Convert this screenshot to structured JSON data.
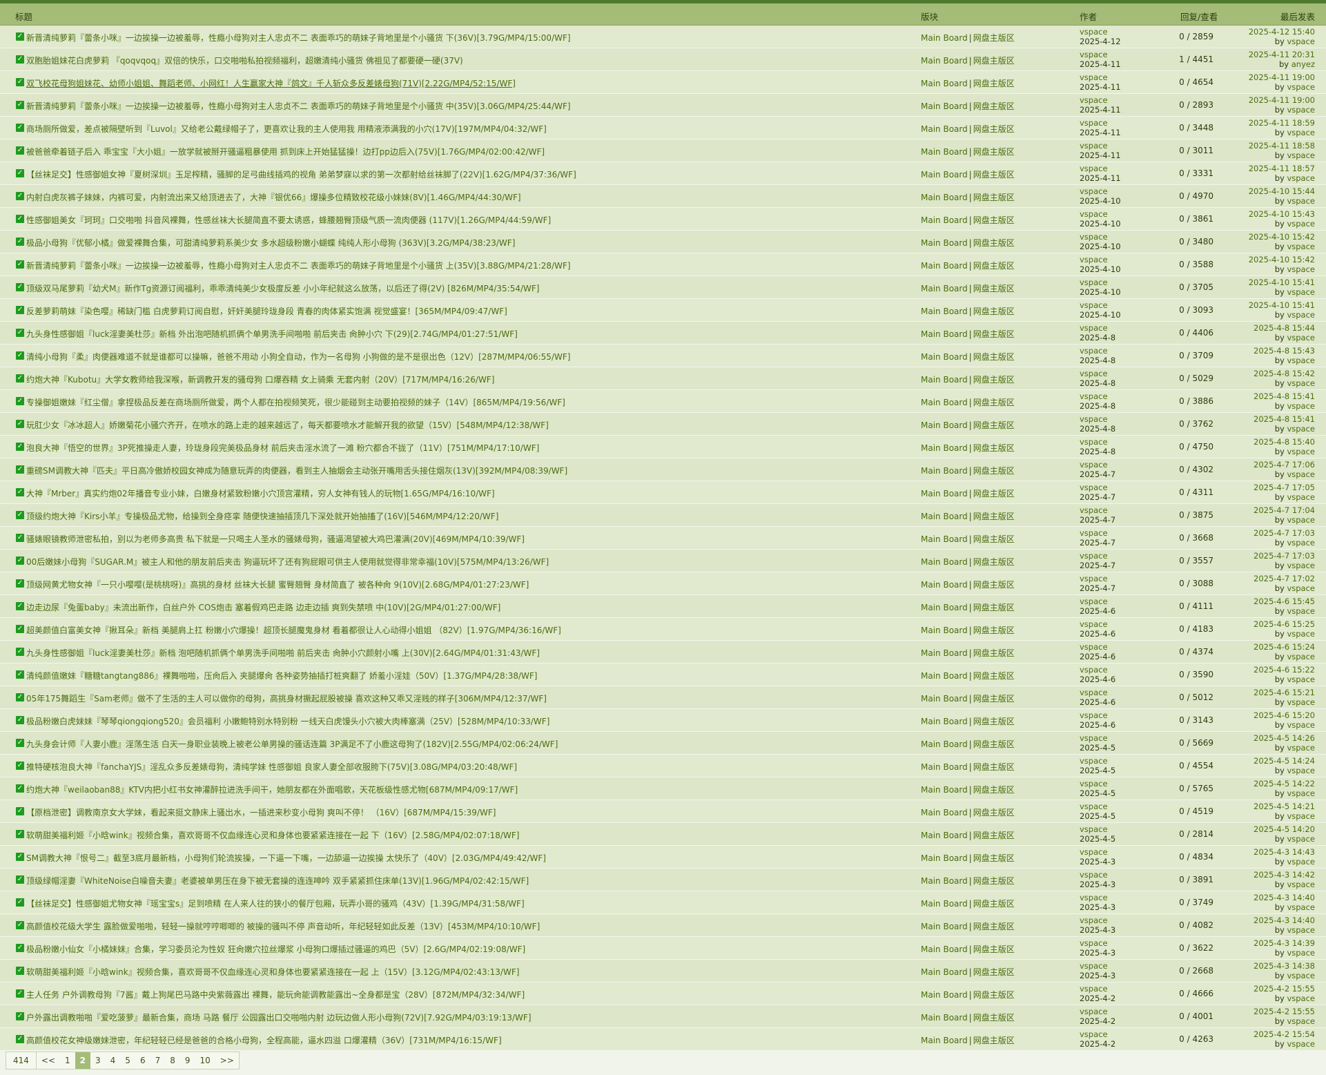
{
  "header": {
    "title": "标题",
    "board": "版块",
    "author": "作者",
    "stats": "回复/查看",
    "last": "最后发表"
  },
  "board_name": [
    "Main Board",
    "网盘主版区"
  ],
  "threads": [
    {
      "title": "新晋清纯萝莉『蕾条小咪』一边挨操一边被羞辱，性瘾小母狗对主人忠贞不二 表面乖巧的萌妹子背地里是个小骚货 下(36V)[3.79G/MP4/15:00/WF]",
      "author": "vspace",
      "date": "2025-4-12",
      "stats": "0 / 2859",
      "last": "2025-4-12 15:40",
      "by": "vspace"
    },
    {
      "title": "双胞胎姐妹花白虎萝莉 『qoqvqoq』双倍的快乐，口交啪啪私拍视频福利，超嫩清纯小骚货 佛祖见了都要硬一硬(37V)",
      "author": "vspace",
      "date": "2025-4-11",
      "stats": "1 / 4451",
      "last": "2025-4-11 20:31",
      "by": "anyez"
    },
    {
      "title": "双飞校花母狗姐妹花、幼师小姐姐、舞蹈老师、小网红！人生赢家大神『鸽文』千人斩众多反差婊母狗(71V)[2.22G/MP4/52:15/WF]",
      "author": "vspace",
      "date": "2025-4-11",
      "stats": "0 / 4654",
      "last": "2025-4-11 19:00",
      "by": "vspace",
      "underline": true
    },
    {
      "title": "新晋清纯萝莉『蕾条小咪』一边挨操一边被羞辱，性瘾小母狗对主人忠贞不二 表面乖巧的萌妹子背地里是个小骚货 中(35V)[3.06G/MP4/25:44/WF]",
      "author": "vspace",
      "date": "2025-4-11",
      "stats": "0 / 2893",
      "last": "2025-4-11 19:00",
      "by": "vspace"
    },
    {
      "title": "商场厕所做爱，差点被隔壁听到『Luvol』又给老公戴绿帽子了，更喜欢让我的主人使用我 用精液添满我的小穴(17V)[197M/MP4/04:32/WF]",
      "author": "vspace",
      "date": "2025-4-11",
      "stats": "0 / 3448",
      "last": "2025-4-11 18:59",
      "by": "vspace"
    },
    {
      "title": "被爸爸牵着链子后入 乖宝宝『大小姐』一放学就被掰开骚逼粗暴使用 抓到床上开始猛猛操！边打pp边后入(75V)[1.76G/MP4/02:00:42/WF]",
      "author": "vspace",
      "date": "2025-4-11",
      "stats": "0 / 3011",
      "last": "2025-4-11 18:58",
      "by": "vspace"
    },
    {
      "title": "【丝袜足交】性感御姐女神『夏树深圳』玉足榨精，骚脚的足弓曲线插鸡的视角 弟弟梦寐以求的第一次都射给丝袜脚了(22V)[1.62G/MP4/37:36/WF]",
      "author": "vspace",
      "date": "2025-4-11",
      "stats": "0 / 3331",
      "last": "2025-4-11 18:57",
      "by": "vspace"
    },
    {
      "title": "内射白虎灰裤子妹妹，内裤可爱，内射流出来又给顶进去了，大神『银优66』爆操多位精致校花级小妹妹(8V)[1.46G/MP4/44:30/WF]",
      "author": "vspace",
      "date": "2025-4-10",
      "stats": "0 / 4970",
      "last": "2025-4-10 15:44",
      "by": "vspace"
    },
    {
      "title": "性感御姐美女『珂珂』口交啪啪 抖音风裸舞，性感丝袜大长腿简直不要太诱惑，蜂腰翘臀顶级气质一流肉便器 (117V)[1.26G/MP4/44:59/WF]",
      "author": "vspace",
      "date": "2025-4-10",
      "stats": "0 / 3861",
      "last": "2025-4-10 15:43",
      "by": "vspace"
    },
    {
      "title": "极品小母狗『优郁小橘』做爱裸舞合集，可甜清纯萝莉系美少女 多水超级粉嫩小蝴蝶 纯纯人形小母狗 (363V)[3.2G/MP4/38:23/WF]",
      "author": "vspace",
      "date": "2025-4-10",
      "stats": "0 / 3480",
      "last": "2025-4-10 15:42",
      "by": "vspace"
    },
    {
      "title": "新晋清纯萝莉『蕾条小咪』一边挨操一边被羞辱，性瘾小母狗对主人忠贞不二 表面乖巧的萌妹子背地里是个小骚货 上(35V)[3.88G/MP4/21:28/WF]",
      "author": "vspace",
      "date": "2025-4-10",
      "stats": "0 / 3588",
      "last": "2025-4-10 15:42",
      "by": "vspace"
    },
    {
      "title": "顶级双马尾萝莉『幼犬M』新作Tg资源订阅福利，乖乖清纯美少女极度反差 小小年纪就这么放荡，以后还了得(2V) [826M/MP4/35:54/WF]",
      "author": "vspace",
      "date": "2025-4-10",
      "stats": "0 / 3705",
      "last": "2025-4-10 15:41",
      "by": "vspace"
    },
    {
      "title": "反差萝莉萌妹『染色嘤』稀缺门槛 白虎萝莉订阅自慰，奸奸美腿玲珑身段 青春的肉体紧实饱满 视觉盛宴！[365M/MP4/09:47/WF]",
      "author": "vspace",
      "date": "2025-4-10",
      "stats": "0 / 3093",
      "last": "2025-4-10 15:41",
      "by": "vspace"
    },
    {
      "title": "九头身性感御姐『luck淫妻美杜莎』新档 外出泡吧随机抓俩个单男洗手间啪啪 前后夹击 肏肿小穴 下(29)[2.74G/MP4/01:27:51/WF]",
      "author": "vspace",
      "date": "2025-4-8",
      "stats": "0 / 4406",
      "last": "2025-4-8 15:44",
      "by": "vspace"
    },
    {
      "title": "清纯小母狗『柔』肉便器难道不就是谁都可以操嘛，爸爸不用动 小狗全自动，作为一名母狗 小狗做的是不是很出色（12V）[287M/MP4/06:55/WF]",
      "author": "vspace",
      "date": "2025-4-8",
      "stats": "0 / 3709",
      "last": "2025-4-8 15:43",
      "by": "vspace"
    },
    {
      "title": "约炮大神『Kubotu』大学女教师给我深喉，新调教开发的骚母狗 口爆吞精 女上骑乘 无套内射（20V）[717M/MP4/16:26/WF]",
      "author": "vspace",
      "date": "2025-4-8",
      "stats": "0 / 5029",
      "last": "2025-4-8 15:42",
      "by": "vspace"
    },
    {
      "title": "专操御姐嫩妹『红尘僧』拿捏极品反差在商场厕所做爱，两个人都在拍视频笑死，很少能碰到主动要拍视频的妹子（14V）[865M/MP4/19:56/WF]",
      "author": "vspace",
      "date": "2025-4-8",
      "stats": "0 / 3886",
      "last": "2025-4-8 15:41",
      "by": "vspace"
    },
    {
      "title": "玩肛少女『冰冰超人』娇嫩菊花小骚穴齐开，在喷水的路上走的越来越远了，每天都要喷水才能解开我的欲望（15V）[548M/MP4/12:38/WF]",
      "author": "vspace",
      "date": "2025-4-8",
      "stats": "0 / 3762",
      "last": "2025-4-8 15:41",
      "by": "vspace"
    },
    {
      "title": "泡良大神『悟空的世界』3P死推操走人妻，玲珑身段完美极品身材 前后夹击淫水流了一滩 粉穴都合不拢了（11V）[751M/MP4/17:10/WF]",
      "author": "vspace",
      "date": "2025-4-8",
      "stats": "0 / 4750",
      "last": "2025-4-8 15:40",
      "by": "vspace"
    },
    {
      "title": "重磅SM调教大神『匹夫』平日高冷傲娇校园女神成为随意玩弄的肉便器，看到主人抽烟会主动张开嘴用舌头接住烟灰(13V)[392M/MP4/08:39/WF]",
      "author": "vspace",
      "date": "2025-4-7",
      "stats": "0 / 4302",
      "last": "2025-4-7 17:06",
      "by": "vspace"
    },
    {
      "title": "大神『Mrber』真实约炮02年播音专业小妹，白嫩身材紧致粉嫩小穴顶宫灌精，穷人女神有钱人的玩物[1.65G/MP4/16:10/WF]",
      "author": "vspace",
      "date": "2025-4-7",
      "stats": "0 / 4311",
      "last": "2025-4-7 17:05",
      "by": "vspace"
    },
    {
      "title": "顶级约炮大神『Kirs小羊』专操极品尤物，给操到全身痉挛 随便快速抽插顶几下深处就开始抽搐了(16V)[546M/MP4/12:20/WF]",
      "author": "vspace",
      "date": "2025-4-7",
      "stats": "0 / 3875",
      "last": "2025-4-7 17:04",
      "by": "vspace"
    },
    {
      "title": "骚婊眼镜教师泄密私拍，别以为老师多高贵 私下就是一只喝主人圣水的骚婊母狗，骚逼渴望被大鸡巴灌满(20V)[469M/MP4/10:39/WF]",
      "author": "vspace",
      "date": "2025-4-7",
      "stats": "0 / 3668",
      "last": "2025-4-7 17:03",
      "by": "vspace"
    },
    {
      "title": "00后嫩妹小母狗『SUGAR.M』被主人和他的朋友前后夹击 狗逼玩坏了还有狗屁眼可供主人使用就觉得非常幸福(10V)[575M/MP4/13:26/WF]",
      "author": "vspace",
      "date": "2025-4-7",
      "stats": "0 / 3557",
      "last": "2025-4-7 17:03",
      "by": "vspace"
    },
    {
      "title": "顶级网黄尤物女神『一只小嘤嘤(是桃桃呀)』高挑的身材 丝袜大长腿 蜜臀翘臀 身材简直了 被各种肏 9(10V)[2.68G/MP4/01:27:23/WF]",
      "author": "vspace",
      "date": "2025-4-7",
      "stats": "0 / 3088",
      "last": "2025-4-7 17:02",
      "by": "vspace"
    },
    {
      "title": "边走边尿『兔蛋baby』未流出新作，白丝户外 COS炮击 塞着假鸡巴走路 边走边插 爽到失禁喷 中(10V)[2G/MP4/01:27:00/WF]",
      "author": "vspace",
      "date": "2025-4-6",
      "stats": "0 / 4111",
      "last": "2025-4-6 15:45",
      "by": "vspace"
    },
    {
      "title": "超美颜值白富美女神『揪耳朵』新档 美腿肩上扛 粉嫩小穴爆操！超顶长腿魔鬼身材 看着都很让人心动得小姐姐 （82V）[1.97G/MP4/36:16/WF]",
      "author": "vspace",
      "date": "2025-4-6",
      "stats": "0 / 4183",
      "last": "2025-4-6 15:25",
      "by": "vspace"
    },
    {
      "title": "九头身性感御姐『luck淫妻美杜莎』新档 泡吧随机抓俩个单男洗手间啪啪 前后夹击 肏肿小穴颜射小嘴 上(30V)[2.64G/MP4/01:31:43/WF]",
      "author": "vspace",
      "date": "2025-4-6",
      "stats": "0 / 4374",
      "last": "2025-4-6 15:24",
      "by": "vspace"
    },
    {
      "title": "清纯颜值嫩妹『糖糖tangtang886』裸舞啪啪，压肏后入 夹腿爆肏 各种姿势抽插打桩爽翻了 娇羞小淫娃（50V）[1.37G/MP4/28:38/WF]",
      "author": "vspace",
      "date": "2025-4-6",
      "stats": "0 / 3590",
      "last": "2025-4-6 15:22",
      "by": "vspace"
    },
    {
      "title": "05年175舞蹈生『Sam老师』做不了生活的主人可以做你的母狗，高挑身材撅起屁股被操 喜欢这种又乖又淫贱的样子[306M/MP4/12:37/WF]",
      "author": "vspace",
      "date": "2025-4-6",
      "stats": "0 / 5012",
      "last": "2025-4-6 15:21",
      "by": "vspace"
    },
    {
      "title": "极品粉嫩白虎妹妹『琴琴qiongqiong520』会员福利 小嫩鲍特别水特别粉 一线天白虎馒头小穴被大肉棒塞满（25V）[528M/MP4/10:33/WF]",
      "author": "vspace",
      "date": "2025-4-6",
      "stats": "0 / 3143",
      "last": "2025-4-6 15:20",
      "by": "vspace"
    },
    {
      "title": "九头身会计师『人妻小鹿』淫荡生活 白天一身职业装晚上被老公单男操的骚话连篇 3P满足不了小鹿这母狗了(182V)[2.55G/MP4/02:06:24/WF]",
      "author": "vspace",
      "date": "2025-4-5",
      "stats": "0 / 5669",
      "last": "2025-4-5 14:26",
      "by": "vspace"
    },
    {
      "title": "推特硬核泡良大神『fanchaYJS』淫乱众多反差婊母狗，清纯学妹 性感御姐 良家人妻全部收服胯下(75V)[3.08G/MP4/03:20:48/WF]",
      "author": "vspace",
      "date": "2025-4-5",
      "stats": "0 / 4554",
      "last": "2025-4-5 14:24",
      "by": "vspace"
    },
    {
      "title": "约炮大神『weilaoban88』KTV内把小红书女神灌醉拉进洗手间干，她朋友都在外面唱歌，天花板级性感尤物[687M/MP4/09:17/WF]",
      "author": "vspace",
      "date": "2025-4-5",
      "stats": "0 / 5765",
      "last": "2025-4-5 14:22",
      "by": "vspace"
    },
    {
      "title": "【原档泄密】调教南京女大学妹，看起来挺文静床上骚出水，一插进来秒变小母狗 爽叫不停！ （16V）[687M/MP4/15:39/WF]",
      "author": "vspace",
      "date": "2025-4-5",
      "stats": "0 / 4519",
      "last": "2025-4-5 14:21",
      "by": "vspace"
    },
    {
      "title": "软萌甜美福利姬『小晗wink』视频合集，喜欢哥哥不仅血缘连心灵和身体也要紧紧连接在一起 下（16V）[2.58G/MP4/02:07:18/WF]",
      "author": "vspace",
      "date": "2025-4-5",
      "stats": "0 / 2814",
      "last": "2025-4-5 14:20",
      "by": "vspace"
    },
    {
      "title": "SM调教大神『恨号二』截至3底月最新档，小母狗们轮流挨操，一下逼一下嘴，一边舔逼一边挨操 太快乐了（40V）[2.03G/MP4/49:42/WF]",
      "author": "vspace",
      "date": "2025-4-3",
      "stats": "0 / 4834",
      "last": "2025-4-3 14:43",
      "by": "vspace"
    },
    {
      "title": "顶级绿帽淫妻『WhiteNoise白噪音夫妻』老婆被单男压在身下被无套操的连连呻吟 双手紧紧抓住床单(13V)[1.96G/MP4/02:42:15/WF]",
      "author": "vspace",
      "date": "2025-4-3",
      "stats": "0 / 3891",
      "last": "2025-4-3 14:42",
      "by": "vspace"
    },
    {
      "title": "【丝袜足交】性感御姐尤物女神『瑶宝宝s』足到喷精 在人来人往的狭小的餐厅包厢，玩弄小哥的骚鸡（43V）[1.39G/MP4/31:58/WF]",
      "author": "vspace",
      "date": "2025-4-3",
      "stats": "0 / 3749",
      "last": "2025-4-3 14:40",
      "by": "vspace"
    },
    {
      "title": "高颜值校花级大学生 露脸做爱啪啪，轻轻一操就哼哼唧唧的 被操的骚叫不停 声音动听，年纪轻轻如此反差（13V）[453M/MP4/10:10/WF]",
      "author": "vspace",
      "date": "2025-4-3",
      "stats": "0 / 4082",
      "last": "2025-4-3 14:40",
      "by": "vspace"
    },
    {
      "title": "极品粉嫩小仙女『小橘妹妹』合集，学习委员沦为性奴 狂肏嫩穴拉丝爆浆 小母狗口爆插过骚逼的鸡巴（5V）[2.6G/MP4/02:19:08/WF]",
      "author": "vspace",
      "date": "2025-4-3",
      "stats": "0 / 3622",
      "last": "2025-4-3 14:39",
      "by": "vspace"
    },
    {
      "title": "软萌甜美福利姬『小晗wink』视频合集，喜欢哥哥不仅血缘连心灵和身体也要紧紧连接在一起 上（15V）[3.12G/MP4/02:43:13/WF]",
      "author": "vspace",
      "date": "2025-4-3",
      "stats": "0 / 2668",
      "last": "2025-4-3 14:38",
      "by": "vspace"
    },
    {
      "title": "主人任务 户外调教母狗『7酱』戴上狗尾巴马路中央紫薇露出 裸舞，能玩肏能调教能露出~全身都是宝（28V）[872M/MP4/32:34/WF]",
      "author": "vspace",
      "date": "2025-4-2",
      "stats": "0 / 4666",
      "last": "2025-4-2 15:55",
      "by": "vspace"
    },
    {
      "title": "户外露出调教啪啪『爱吃菠萝』最新合集，商场 马路 餐厅 公园露出口交啪啪内射 边玩边做人形小母狗(72V)[7.92G/MP4/03:19:13/WF]",
      "author": "vspace",
      "date": "2025-4-2",
      "stats": "0 / 4001",
      "last": "2025-4-2 15:55",
      "by": "vspace"
    },
    {
      "title": "高颜值校花女神级嫩妹泄密，年纪轻轻已经是爸爸的合格小母狗，全程高能，逼水四溢 口爆灌精（36V）[731M/MP4/16:15/WF]",
      "author": "vspace",
      "date": "2025-4-2",
      "stats": "0 / 4263",
      "last": "2025-4-2 15:54",
      "by": "vspace"
    }
  ],
  "by_label": "by",
  "pager": {
    "total": "414",
    "prev": "<<",
    "pages": [
      "1",
      "2",
      "3",
      "4",
      "5",
      "6",
      "7",
      "8",
      "9",
      "10"
    ],
    "current": "2",
    "next": ">>"
  },
  "colors": {
    "header": "#a4bc78",
    "row": "#e1e9cf",
    "check": "#1e9b1e",
    "link": "#4a6d0c"
  }
}
